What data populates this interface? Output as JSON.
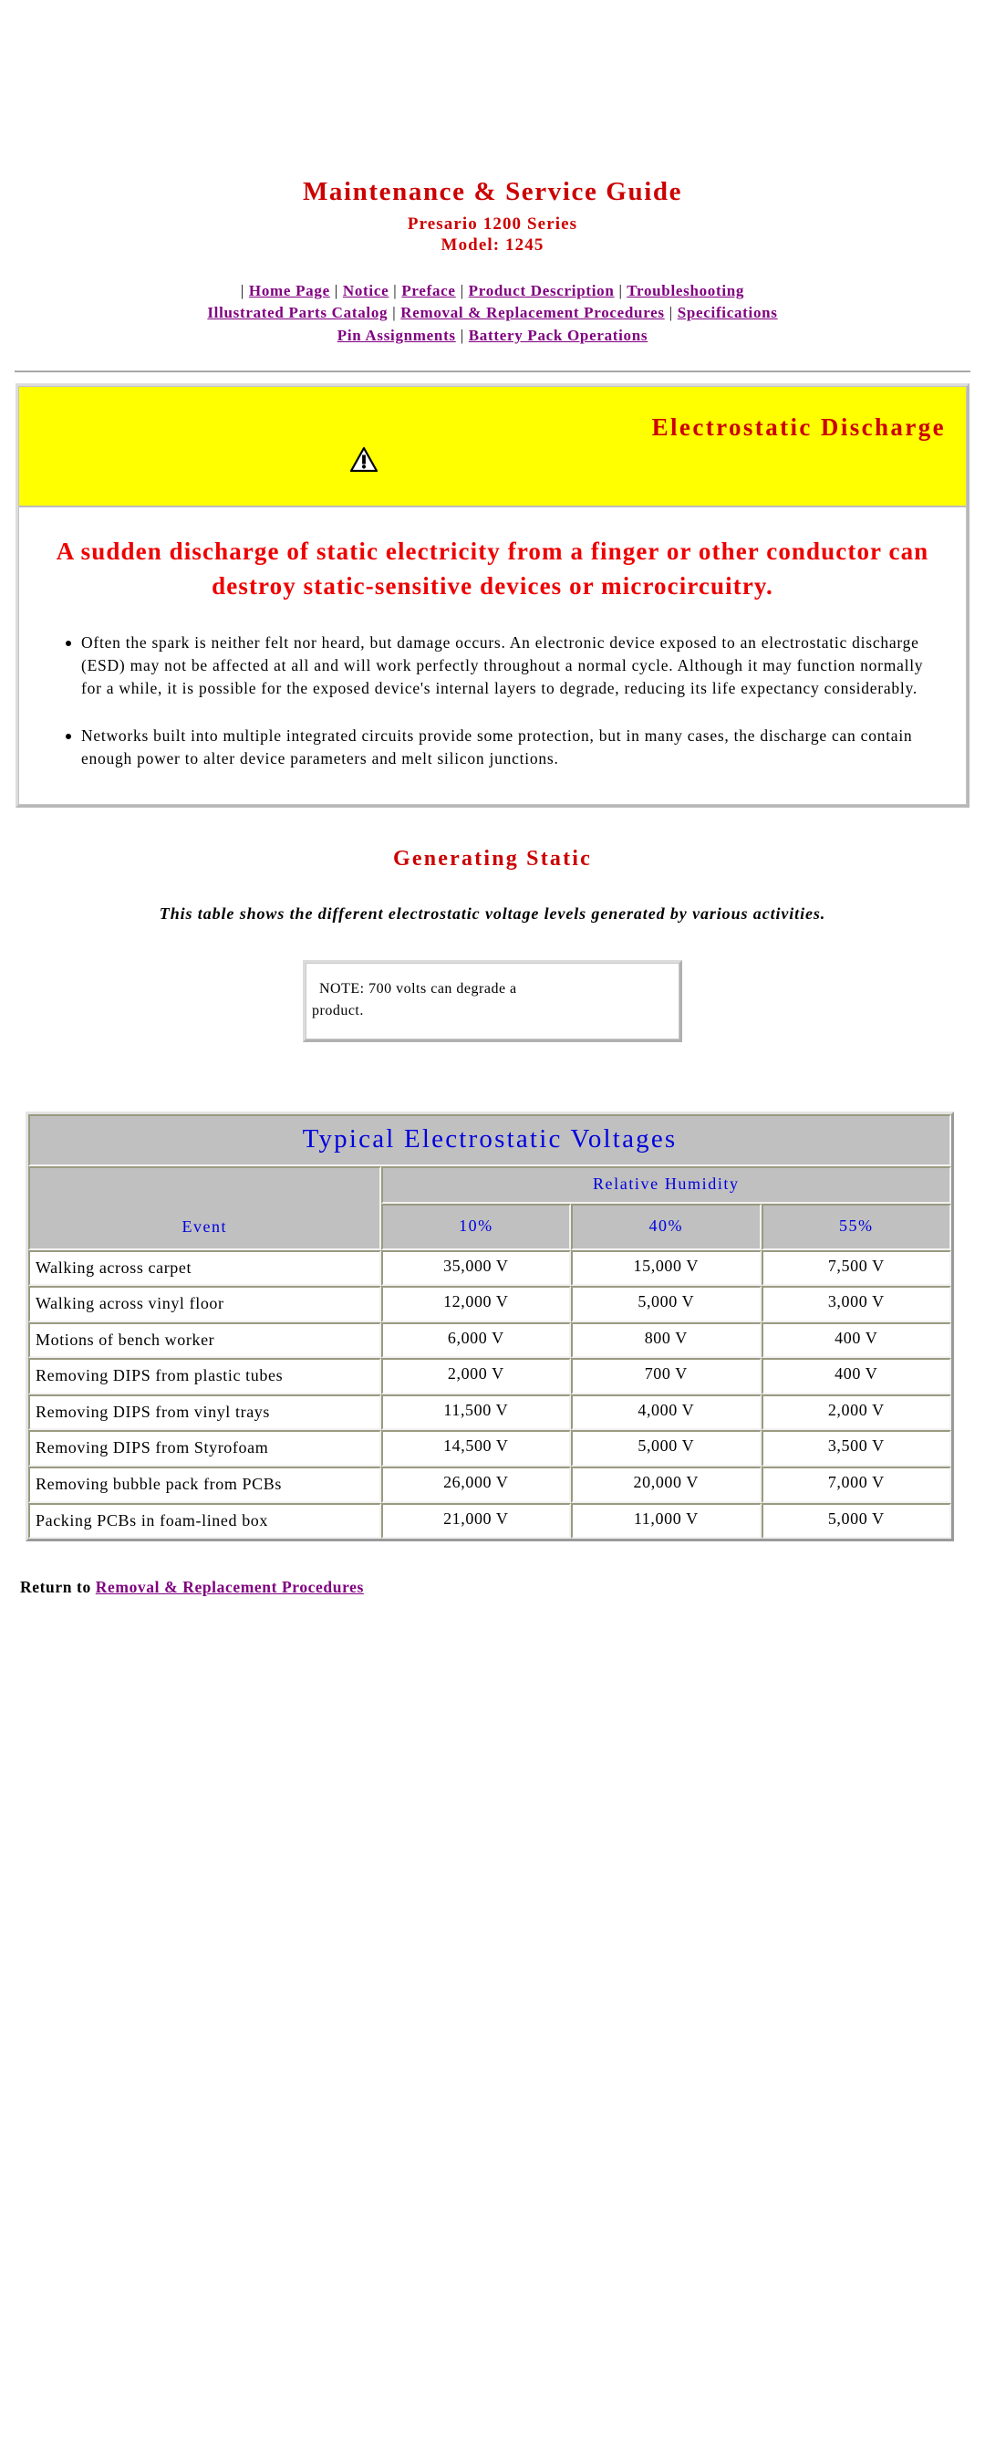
{
  "header": {
    "title": "Maintenance & Service Guide",
    "subtitle": "Presario 1200 Series",
    "model": "Model: 1245",
    "nav_links": [
      "Home Page",
      "Notice",
      "Preface",
      "Product Description",
      "Troubleshooting",
      "Illustrated Parts Catalog",
      "Removal & Replacement Procedures",
      "Specifications",
      "Pin Assignments",
      "Battery Pack Operations"
    ],
    "separator": "|"
  },
  "warning_panel": {
    "banner_title": "Electrostatic Discharge",
    "banner_icon": "warning-triangle-icon",
    "banner_bg": "#ffff00",
    "lead_text": "A sudden discharge of static electricity from a finger or other conductor can destroy static-sensitive devices or microcircuitry.",
    "lead_color": "#ee0000",
    "bullets": [
      "Often the spark is neither felt nor heard, but damage occurs. An electronic device exposed to an electrostatic discharge (ESD) may not be affected at all and will work perfectly throughout a normal cycle.  Although it may function normally for a while, it is possible for the exposed device's internal layers to degrade, reducing its life expectancy considerably.",
      "Networks built into multiple integrated circuits provide some protection, but in many cases, the discharge can contain enough power to alter device parameters and melt silicon junctions."
    ]
  },
  "generating_static": {
    "heading": "Generating Static",
    "heading_color": "#cc0000",
    "description": "This table shows the different electrostatic voltage levels generated by various activities.",
    "note_line1": "NOTE: 700 volts can degrade a",
    "note_line2": "product."
  },
  "table": {
    "title": "Typical Electrostatic Voltages",
    "title_color": "#0000dd",
    "group_header": "Relative Humidity",
    "event_header": "Event",
    "humidity_columns": [
      "10%",
      "40%",
      "55%"
    ],
    "rows": [
      {
        "event": "Walking across carpet",
        "v10": "35,000 V",
        "v40": "15,000 V",
        "v55": "7,500 V"
      },
      {
        "event": "Walking across vinyl floor",
        "v10": "12,000 V",
        "v40": "5,000 V",
        "v55": "3,000 V"
      },
      {
        "event": "Motions of bench worker",
        "v10": "6,000 V",
        "v40": "800 V",
        "v55": "400 V"
      },
      {
        "event": "Removing DIPS from plastic tubes",
        "v10": "2,000 V",
        "v40": "700 V",
        "v55": "400 V"
      },
      {
        "event": "Removing DIPS from vinyl trays",
        "v10": "11,500 V",
        "v40": "4,000 V",
        "v55": "2,000 V"
      },
      {
        "event": "Removing DIPS from Styrofoam",
        "v10": "14,500 V",
        "v40": "5,000 V",
        "v55": "3,500 V"
      },
      {
        "event": "Removing bubble pack from PCBs",
        "v10": "26,000 V",
        "v40": "20,000 V",
        "v55": "7,000 V"
      },
      {
        "event": "Packing PCBs in foam-lined box",
        "v10": "21,000 V",
        "v40": "11,000 V",
        "v55": "5,000 V"
      }
    ]
  },
  "footer": {
    "prefix": "Return to ",
    "link": "Removal & Replacement Procedures"
  }
}
